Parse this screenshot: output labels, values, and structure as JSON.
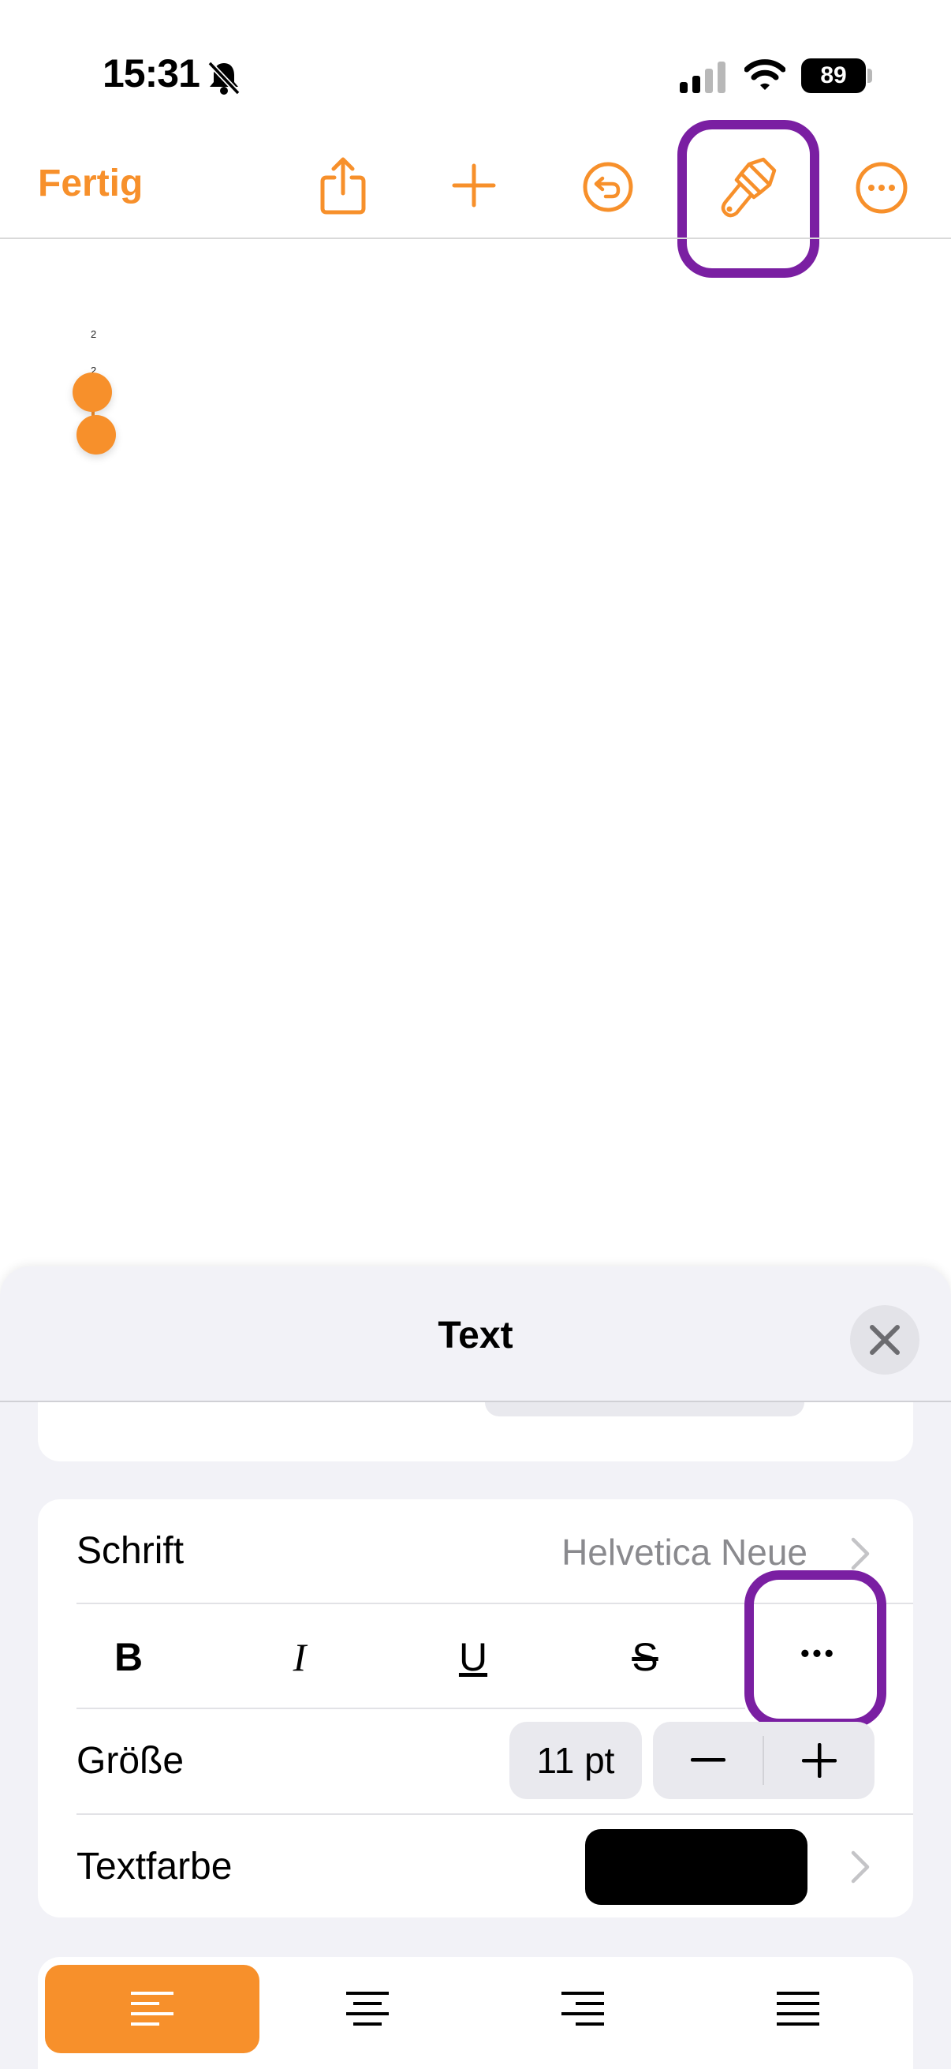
{
  "status_bar": {
    "time": "15:31",
    "battery": "89"
  },
  "toolbar": {
    "done_label": "Fertig"
  },
  "document": {
    "page_label_top": "2",
    "page_label_bottom": "2"
  },
  "panel": {
    "title": "Text",
    "font_row": {
      "label": "Schrift",
      "value": "Helvetica Neue"
    },
    "style_buttons": {
      "bold": "B",
      "italic": "I",
      "underline": "U",
      "strike": "S",
      "more": "•••"
    },
    "size_row": {
      "label": "Größe",
      "value": "11 pt",
      "minus": "–",
      "plus": "+"
    },
    "color_row": {
      "label": "Textfarbe",
      "swatch_color": "#000000"
    },
    "alignment": {
      "selected": "left",
      "options": [
        "left",
        "center",
        "right",
        "justify"
      ]
    }
  },
  "colors": {
    "accent": "#f7902b",
    "highlight": "#7a1fa2",
    "panel_bg": "#f2f2f7"
  },
  "icons": [
    "bell-slash-icon",
    "signal-icon",
    "wifi-icon",
    "share-icon",
    "add-icon",
    "undo-icon",
    "paintbrush-icon",
    "more-icon",
    "close-icon",
    "chevron-right-icon",
    "align-left-icon",
    "align-center-icon",
    "align-right-icon",
    "align-justify-icon"
  ]
}
